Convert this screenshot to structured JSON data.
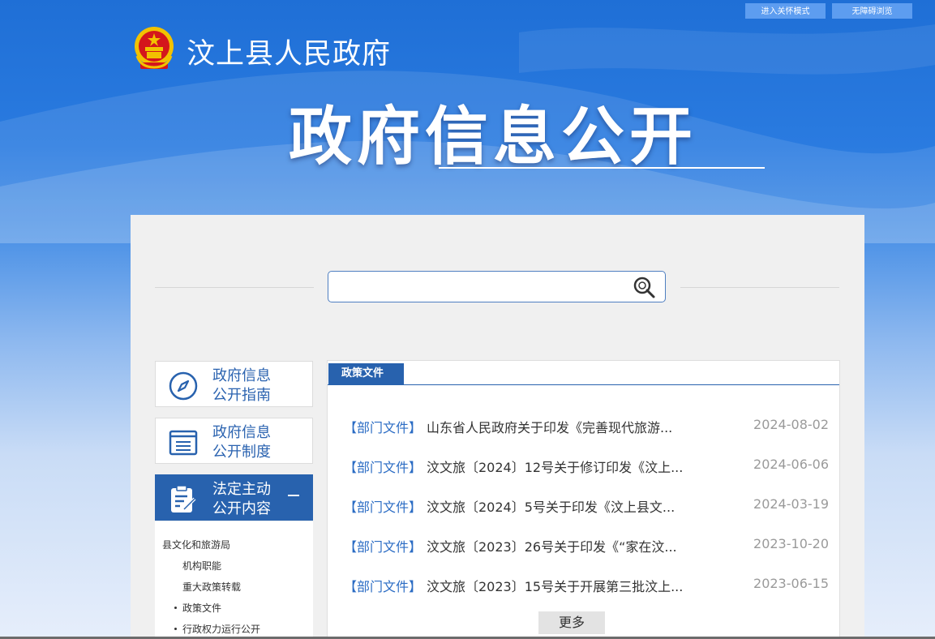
{
  "top_buttons": {
    "care_mode": "进入关怀模式",
    "accessible": "无障碍浏览"
  },
  "header": {
    "site_name": "汶上县人民政府",
    "main_title": "政府信息公开",
    "emblem_icon": "national-emblem-icon"
  },
  "search": {
    "placeholder": "",
    "value": "",
    "icon": "search-icon"
  },
  "sidebar": {
    "cards": [
      {
        "line1": "政府信息",
        "line2": "公开指南",
        "icon": "compass-icon"
      },
      {
        "line1": "政府信息",
        "line2": "公开制度",
        "icon": "document-list-icon"
      },
      {
        "line1": "法定主动",
        "line2": "公开内容",
        "icon": "clipboard-edit-icon",
        "active": true
      }
    ],
    "sub_items": [
      "县文化和旅游局",
      "机构职能",
      "重大政策转载",
      "政策文件",
      "行政权力运行公开"
    ]
  },
  "news": {
    "tab_label": "政策文件",
    "items": [
      {
        "tag": "【部门文件】",
        "title": "山东省人民政府关于印发《完善现代旅游...",
        "date": "2024-08-02"
      },
      {
        "tag": "【部门文件】",
        "title": "汶文旅〔2024〕12号关于修订印发《汶上...",
        "date": "2024-06-06"
      },
      {
        "tag": "【部门文件】",
        "title": "汶文旅〔2024〕5号关于印发《汶上县文...",
        "date": "2024-03-19"
      },
      {
        "tag": "【部门文件】",
        "title": "汶文旅〔2023〕26号关于印发《“家在汶...",
        "date": "2023-10-20"
      },
      {
        "tag": "【部门文件】",
        "title": "汶文旅〔2023〕15号关于开展第三批汶上...",
        "date": "2023-06-15"
      }
    ],
    "more_label": "更多"
  },
  "colors": {
    "brand_blue": "#2862ae",
    "tag_blue": "#2b6cc4",
    "header_blue": "#1f6fd6"
  }
}
